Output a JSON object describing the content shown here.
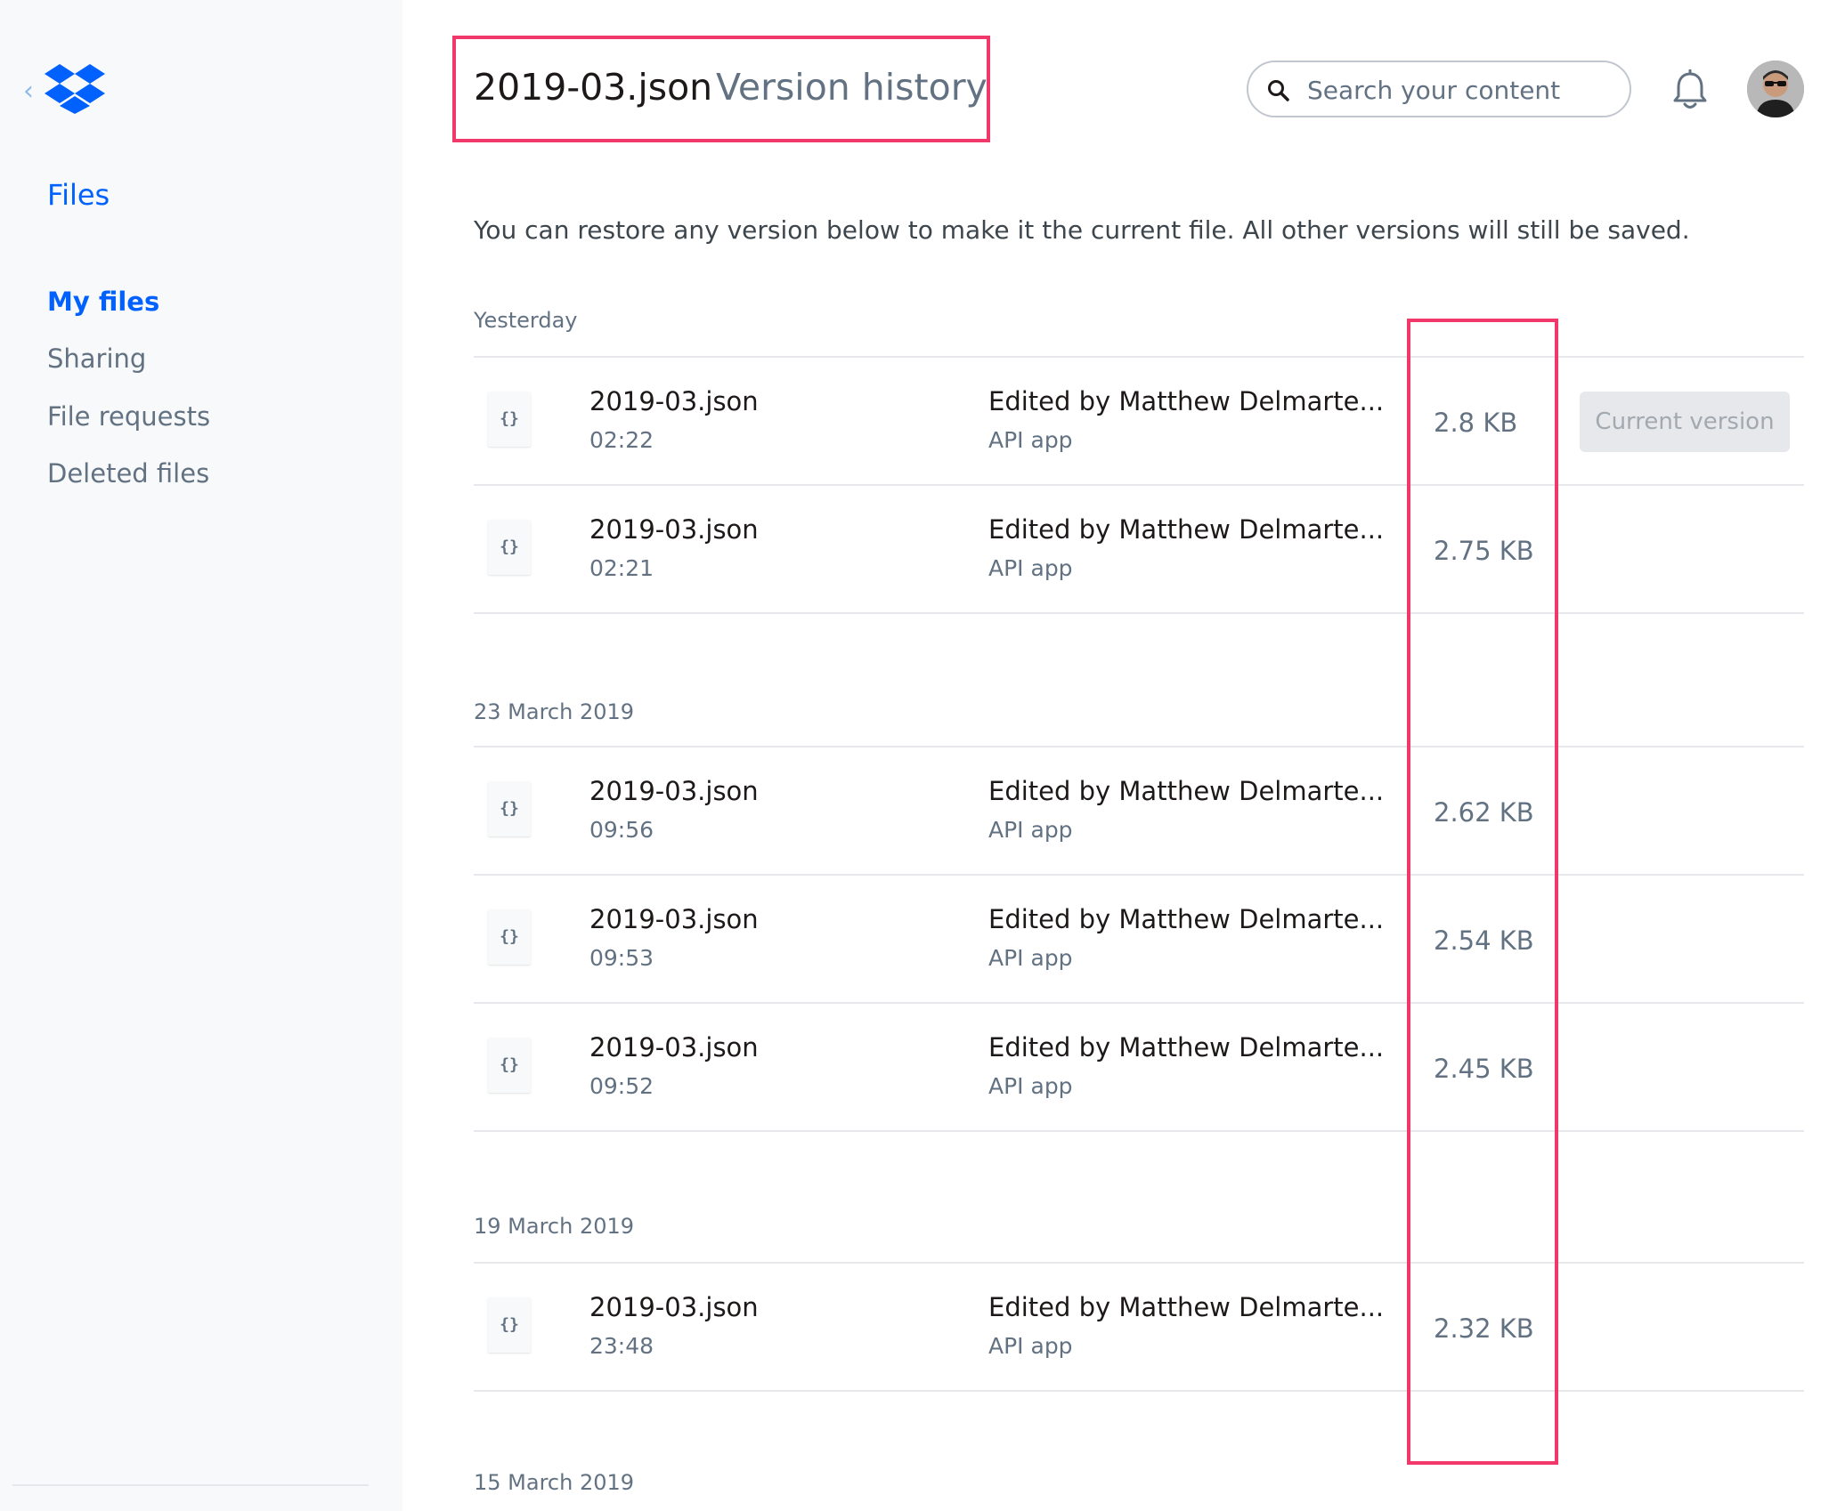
{
  "sidebar": {
    "back_icon": "chevron-left-icon",
    "logo_icon": "dropbox-logo-icon",
    "files_label": "Files",
    "nav": [
      {
        "label": "My files",
        "active": true
      },
      {
        "label": "Sharing",
        "active": false
      },
      {
        "label": "File requests",
        "active": false
      },
      {
        "label": "Deleted files",
        "active": false
      }
    ]
  },
  "header": {
    "file_name": "2019-03.json",
    "page_label": "Version history",
    "search_placeholder": "Search your content",
    "bell_icon": "bell-icon",
    "avatar_icon": "avatar"
  },
  "main": {
    "intro": "You can restore any version below to make it the current file. All other versions will still be saved.",
    "groups": [
      {
        "label": "Yesterday",
        "versions": [
          {
            "name": "2019-03.json",
            "time": "02:22",
            "editor": "Edited by Matthew Delmarte...",
            "source": "API app",
            "size": "2.8 KB",
            "action": "Current version"
          },
          {
            "name": "2019-03.json",
            "time": "02:21",
            "editor": "Edited by Matthew Delmarte...",
            "source": "API app",
            "size": "2.75 KB"
          }
        ]
      },
      {
        "label": "23 March 2019",
        "versions": [
          {
            "name": "2019-03.json",
            "time": "09:56",
            "editor": "Edited by Matthew Delmarte...",
            "source": "API app",
            "size": "2.62 KB"
          },
          {
            "name": "2019-03.json",
            "time": "09:53",
            "editor": "Edited by Matthew Delmarte...",
            "source": "API app",
            "size": "2.54 KB"
          },
          {
            "name": "2019-03.json",
            "time": "09:52",
            "editor": "Edited by Matthew Delmarte...",
            "source": "API app",
            "size": "2.45 KB"
          }
        ]
      },
      {
        "label": "19 March 2019",
        "versions": [
          {
            "name": "2019-03.json",
            "time": "23:48",
            "editor": "Edited by Matthew Delmarte...",
            "source": "API app",
            "size": "2.32 KB"
          }
        ]
      },
      {
        "label": "15 March 2019",
        "versions": []
      }
    ],
    "file_icon_glyph": "{}",
    "file_icon": "json-file-icon"
  },
  "colors": {
    "accent": "#0061fe",
    "highlight": "#f0386b",
    "muted": "#637282"
  }
}
